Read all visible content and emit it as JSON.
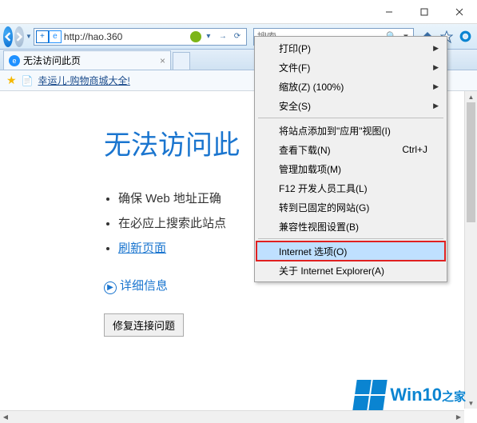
{
  "titlebar": {
    "min": "—",
    "max": "☐",
    "close": "✕"
  },
  "toolbar": {
    "url": "http://hao.360",
    "search_placeholder": "搜索..."
  },
  "tab": {
    "title": "无法访问此页",
    "close": "×"
  },
  "favorites": {
    "item1": "幸运儿-购物商城大全!"
  },
  "error": {
    "title": "无法访问此",
    "bullets": [
      "确保 Web 地址正确",
      "在必应上搜索此站点"
    ],
    "refresh": "刷新页面",
    "detail": "详细信息",
    "fix_button": "修复连接问题"
  },
  "menu": {
    "items": [
      {
        "label": "打印(P)",
        "sub": true
      },
      {
        "label": "文件(F)",
        "sub": true
      },
      {
        "label": "缩放(Z) (100%)",
        "sub": true
      },
      {
        "label": "安全(S)",
        "sub": true
      }
    ],
    "items2": [
      {
        "label": "将站点添加到\"应用\"视图(I)"
      },
      {
        "label": "查看下载(N)",
        "shortcut": "Ctrl+J"
      },
      {
        "label": "管理加载项(M)"
      },
      {
        "label": "F12 开发人员工具(L)"
      },
      {
        "label": "转到已固定的网站(G)"
      },
      {
        "label": "兼容性视图设置(B)"
      }
    ],
    "items3": [
      {
        "label": "Internet 选项(O)",
        "hl": true
      },
      {
        "label": "关于 Internet Explorer(A)"
      }
    ]
  },
  "watermark": {
    "brand": "Win10",
    "suffix": "之家"
  }
}
